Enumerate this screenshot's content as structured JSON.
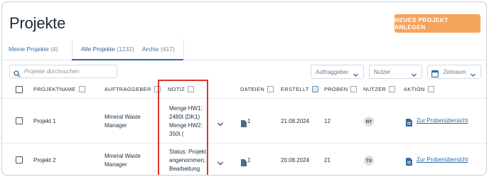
{
  "page": {
    "title": "Projekte",
    "new_button": "NEUES PROJEKT ANLEGEN"
  },
  "tabs": [
    {
      "label": "Meine Projekte",
      "count": "(4)"
    },
    {
      "label": "Alle Projekte",
      "count": "(1232)",
      "active": true
    },
    {
      "label": "Archiv",
      "count": "(417)"
    }
  ],
  "filters": {
    "search_placeholder": "Projekte durchsuchen",
    "auftraggeber": "Auftraggeber",
    "nutzer": "Nutzer",
    "zeitraum": "Zeitraum"
  },
  "table": {
    "columns": {
      "projektname": "PROJEKTNAME",
      "auftraggeber": "AUFTRAGGEBER",
      "notiz": "NOTIZ",
      "dateien": "DATEIEN",
      "erstellt": "ERSTELLT",
      "proben": "PROBEN",
      "nutzer": "NUTZER",
      "aktion": "AKTION"
    },
    "rows": [
      {
        "name": "Projekt 1",
        "auftraggeber": [
          "Mineral Waste",
          "Manager"
        ],
        "notiz": [
          "Menge HW1:",
          "2480t (DK1)",
          "Menge HW2:",
          "350t ("
        ],
        "dateien": "1",
        "erstellt": "21.08.2024",
        "proben": "12",
        "nutzer": "NY",
        "aktion": "Zur Probenübersicht"
      },
      {
        "name": "Projekt 2",
        "auftraggeber": [
          "Mineral Waste",
          "Manager"
        ],
        "notiz": [
          "Status: Projekt",
          "angenommen,",
          "Bearbeitung"
        ],
        "dateien": "1",
        "erstellt": "20.08.2024",
        "proben": "21",
        "nutzer": "TS",
        "aktion": "Zur Probenübersicht"
      }
    ]
  },
  "colors": {
    "accent": "#f5a45d",
    "link": "#2e6ba6",
    "highlight": "#e0342c"
  }
}
